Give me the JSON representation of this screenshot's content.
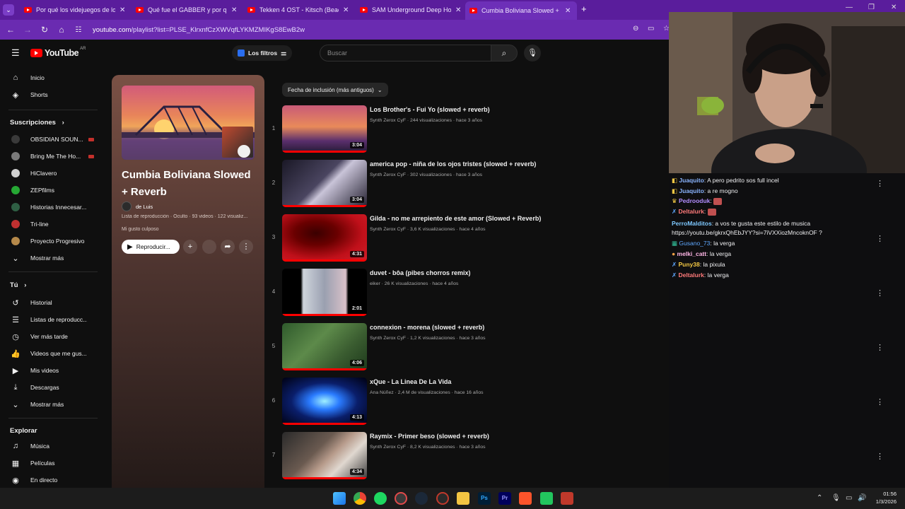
{
  "browser": {
    "tabs": [
      {
        "title": "Por qué los videjuegos de los 2"
      },
      {
        "title": "Qué fue el GABBER y por qué a"
      },
      {
        "title": "Tekken 4 OST - Kitsch (Beach St"
      },
      {
        "title": "SAM Underground Deep House"
      },
      {
        "title": "Cumbia Boliviana Slowed + Re"
      }
    ],
    "new_tab_glyph": "+",
    "url_host": "youtube.com",
    "url_path": "/playlist?list=PLSE_KlrxnfCzXWVqfLYKMZMIKgS8EwB2w"
  },
  "youtube": {
    "logo_text": "YouTube",
    "country_code": "AR",
    "filters_label": "Los filtros",
    "search_placeholder": "Buscar",
    "sidebar": {
      "top": [
        {
          "label": "Inicio",
          "icon": "home-icon"
        },
        {
          "label": "Shorts",
          "icon": "shorts-icon"
        }
      ],
      "subs_header": "Suscripciones",
      "subs": [
        {
          "label": "OBSIDIAN SOUN...",
          "color": "#3a3a3a",
          "live": true
        },
        {
          "label": "Bring Me The Ho...",
          "color": "#7a7a7a",
          "live": true
        },
        {
          "label": "HiClavero",
          "color": "#d0d0d0",
          "live": false
        },
        {
          "label": "ZEPfilms",
          "color": "#26a834",
          "live": false
        },
        {
          "label": "Historias Innecesar...",
          "color": "#2f5f44",
          "live": false
        },
        {
          "label": "Tri-line",
          "color": "#c03030",
          "live": false
        },
        {
          "label": "Proyecto Progresivo",
          "color": "#b5894a",
          "live": false
        }
      ],
      "more1": "Mostrar más",
      "you_header": "Tú",
      "you": [
        {
          "label": "Historial",
          "icon": "history-icon"
        },
        {
          "label": "Listas de reproducc...",
          "icon": "playlists-icon"
        },
        {
          "label": "Ver más tarde",
          "icon": "watch-later-icon"
        },
        {
          "label": "Videos que me gus...",
          "icon": "liked-videos-icon"
        },
        {
          "label": "Mis videos",
          "icon": "my-videos-icon"
        },
        {
          "label": "Descargas",
          "icon": "downloads-icon"
        }
      ],
      "more2": "Mostrar más",
      "explore_header": "Explorar",
      "explore": [
        {
          "label": "Música",
          "icon": "music-icon"
        },
        {
          "label": "Películas",
          "icon": "movies-icon"
        },
        {
          "label": "En directo",
          "icon": "live-icon"
        }
      ]
    },
    "playlist": {
      "title": "Cumbia Boliviana Slowed + Reverb",
      "owner": "de Luis",
      "meta": "Lista de reproducción · Oculto · 93 videos · 122 visualiz...",
      "description": "Mi gusto culposo",
      "play_label": "Reproducir...",
      "sort_label": "Fecha de inclusión (más antiguos)"
    },
    "videos": [
      {
        "idx": "1",
        "title": "Los Brother's - Fui Yo (slowed + reverb)",
        "meta": "Synth Zerox CyF · 244 visualizaciones · hace 3 años",
        "duration": "3:04",
        "bg": "linear-gradient(180deg,#c85a78 0%,#e98a5a 45%,#5a2f6d 75%,#261a33 100%)"
      },
      {
        "idx": "2",
        "title": "america pop - niña de los ojos tristes (slowed + reverb)",
        "meta": "Synth Zerox CyF · 302 visualizaciones · hace 3 años",
        "duration": "3:04",
        "bg": "linear-gradient(135deg,#1a1826 0%,#4a4560 45%,#c9c4d8 55%,#242030 100%)"
      },
      {
        "idx": "3",
        "title": "Gilda - no me arrepiento de este amor (Slowed + Reverb)",
        "meta": "Synth Zerox CyF · 3,6 K visualizaciones · hace 4 años",
        "duration": "4:31",
        "bg": "radial-gradient(ellipse at 40% 40%,#3a0000 0%,#6a0000 30%,#c0101a 65%,#d0202a 100%)"
      },
      {
        "idx": "4",
        "title": "duvet - bôa (pibes chorros remix)",
        "meta": "eiker · 26 K visualizaciones · hace 4 años",
        "duration": "2:01",
        "bg": "linear-gradient(90deg,#000 0%,#000 22%,#cfd4dc 25%,#9aa0b0 50%,#d8c0c8 75%,#000 78%,#000 100%)"
      },
      {
        "idx": "5",
        "title": "connexion - morena (slowed + reverb)",
        "meta": "Synth Zerox CyF · 1,2 K visualizaciones · hace 3 años",
        "duration": "4:06",
        "bg": "linear-gradient(135deg,#2f5a2c 0%,#5d8a4a 40%,#3a5c30 70%,#1e3a1c 100%)"
      },
      {
        "idx": "6",
        "title": "xQue - La Linea De La Vida",
        "meta": "Ana Núñez · 2,4 M de visualizaciones · hace 16 años",
        "duration": "4:13",
        "bg": "radial-gradient(ellipse at 50% 50%,#9ff0ff 0%,#2a7bff 25%,#0a1e6a 55%,#000010 100%)"
      },
      {
        "idx": "7",
        "title": "Raymix - Primer beso (slowed + reverb)",
        "meta": "Synth Zerox CyF · 8,2 K visualizaciones · hace 3 años",
        "duration": "4:34",
        "bg": "linear-gradient(135deg,#2a2a2a 0%,#6a5a50 40%,#b69a8a 55%,#e0d8d0 70%,#3a3a3a 100%)"
      }
    ]
  },
  "chat": {
    "messages": [
      {
        "name": "Juaquito",
        "color": "#8ab4ff",
        "text": ": A pero pedrito sos full incel"
      },
      {
        "name": "Juaquito",
        "color": "#8ab4ff",
        "text": ": a re mogno"
      },
      {
        "name": "Pedrooduk",
        "color": "#b28dff",
        "text": ": "
      },
      {
        "name": "Deltalurk",
        "color": "#ff7a7a",
        "text": ": "
      },
      {
        "name": "PerroMalditos",
        "color": "#7ec8ff",
        "text": ": a vos te gusta este estilo de musica"
      },
      {
        "name": "",
        "color": "#efeff1",
        "text": "https://youtu.be/gkrxQhEbJYY?si=7iVXXiozMncoknOF ?"
      },
      {
        "name": "Gusano_73",
        "color": "#5fa8ff",
        "text": ": la verga"
      },
      {
        "name": "melki_catt",
        "color": "#ffb6e6",
        "text": ": la verga"
      },
      {
        "name": "Puny38",
        "color": "#f2c744",
        "text": ": la pixula"
      },
      {
        "name": "Deltalurk",
        "color": "#ff7a7a",
        "text": ": la verga"
      }
    ]
  },
  "taskbar": {
    "time": "01:56",
    "date": "1/3/2026",
    "apps": [
      "windows-start-icon",
      "chrome-icon",
      "spotify-icon",
      "app-icon",
      "steam-icon",
      "app-icon-2",
      "file-explorer-icon",
      "photoshop-icon",
      "premiere-icon",
      "brave-icon",
      "app-green-icon",
      "voicemeeter-icon"
    ]
  }
}
